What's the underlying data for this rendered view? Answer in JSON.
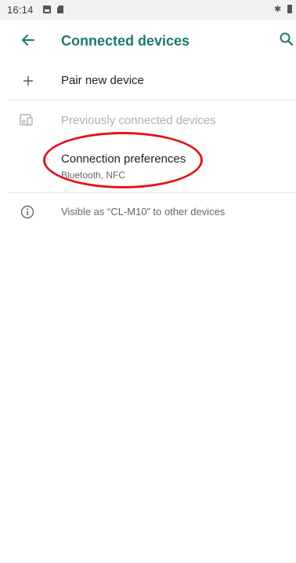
{
  "status_bar": {
    "time": "16:14",
    "icons": [
      "gallery-icon",
      "sd-card-icon",
      "bluetooth-icon",
      "battery-icon"
    ]
  },
  "app_bar": {
    "title": "Connected devices",
    "back_icon": "back-arrow-icon",
    "search_icon": "search-icon"
  },
  "items": {
    "pair_new": {
      "label": "Pair new device",
      "icon": "plus-icon"
    },
    "previously_connected": {
      "label": "Previously connected devices",
      "icon": "devices-icon"
    },
    "connection_preferences": {
      "label": "Connection preferences",
      "subtitle": "Bluetooth, NFC"
    },
    "visible_as": {
      "label": "Visible as “CL-M10” to other devices",
      "icon": "info-icon"
    }
  },
  "colors": {
    "accent": "#1b7a72",
    "annotation": "#e3131b",
    "status_bar_bg": "#f2f2f2",
    "disabled_text": "#b0b0b0"
  }
}
